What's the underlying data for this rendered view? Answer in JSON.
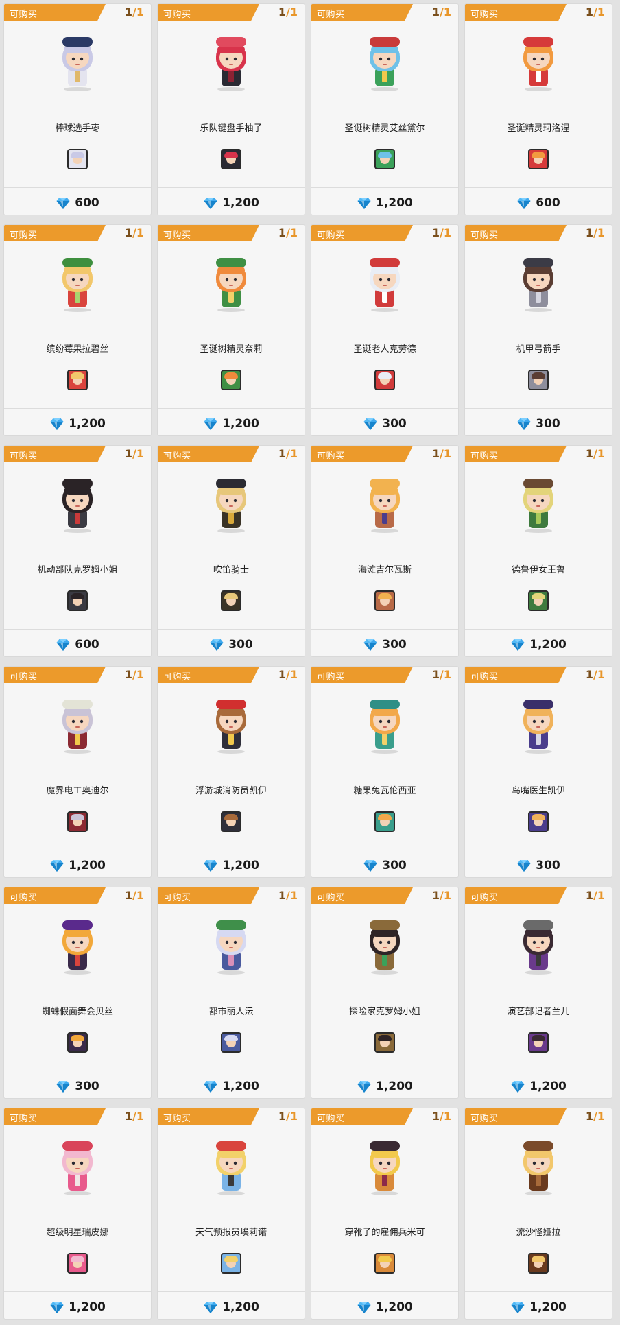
{
  "shop": {
    "cards": [
      {
        "badge": "可购买",
        "stock_current": "1",
        "stock_max": "1",
        "name": "棒球选手枣",
        "price": "600",
        "colors": {
          "hair": "#c9c9e6",
          "hat": "#2b3a66",
          "outfit": "#e4e4ef",
          "accent": "#e0b86a"
        }
      },
      {
        "badge": "可购买",
        "stock_current": "1",
        "stock_max": "1",
        "name": "乐队键盘手柚子",
        "price": "1,200",
        "colors": {
          "hair": "#d8334b",
          "hat": "#e14a5e",
          "outfit": "#2a2a33",
          "accent": "#8c2233"
        }
      },
      {
        "badge": "可购买",
        "stock_current": "1",
        "stock_max": "1",
        "name": "圣诞树精灵艾丝黛尔",
        "price": "1,200",
        "colors": {
          "hair": "#6fc1e8",
          "hat": "#c93a3a",
          "outfit": "#3ba15a",
          "accent": "#f2c94c"
        }
      },
      {
        "badge": "可购买",
        "stock_current": "1",
        "stock_max": "1",
        "name": "圣诞精灵珂洛涅",
        "price": "600",
        "colors": {
          "hair": "#f29a3f",
          "hat": "#d63a3a",
          "outfit": "#d63a3a",
          "accent": "#ffffff"
        }
      },
      {
        "badge": "可购买",
        "stock_current": "1",
        "stock_max": "1",
        "name": "缤纷莓果拉碧丝",
        "price": "1,200",
        "colors": {
          "hair": "#f2c76b",
          "hat": "#3e8f3e",
          "outfit": "#d9443d",
          "accent": "#a8d46f"
        }
      },
      {
        "badge": "可购买",
        "stock_current": "1",
        "stock_max": "1",
        "name": "圣诞树精灵奈莉",
        "price": "1,200",
        "colors": {
          "hair": "#f08a3c",
          "hat": "#3f8f44",
          "outfit": "#3f8f44",
          "accent": "#f2d16a"
        }
      },
      {
        "badge": "可购买",
        "stock_current": "1",
        "stock_max": "1",
        "name": "圣诞老人克劳德",
        "price": "300",
        "colors": {
          "hair": "#e9edf5",
          "hat": "#d13b3b",
          "outfit": "#d13b3b",
          "accent": "#ffffff"
        }
      },
      {
        "badge": "可购买",
        "stock_current": "1",
        "stock_max": "1",
        "name": "机甲弓箭手",
        "price": "300",
        "colors": {
          "hair": "#5a3d33",
          "hat": "#3b3b46",
          "outfit": "#8e8e9c",
          "accent": "#d6d6e0"
        }
      },
      {
        "badge": "可购买",
        "stock_current": "1",
        "stock_max": "1",
        "name": "机动部队克罗姆小姐",
        "price": "600",
        "colors": {
          "hair": "#2a2326",
          "hat": "#2a2326",
          "outfit": "#3a3a42",
          "accent": "#c93a3a"
        }
      },
      {
        "badge": "可购买",
        "stock_current": "1",
        "stock_max": "1",
        "name": "吹笛骑士",
        "price": "300",
        "colors": {
          "hair": "#e7c77a",
          "hat": "#2b2b33",
          "outfit": "#3a3326",
          "accent": "#d9a93a"
        }
      },
      {
        "badge": "可购买",
        "stock_current": "1",
        "stock_max": "1",
        "name": "海滩吉尔瓦斯",
        "price": "300",
        "colors": {
          "hair": "#f2b24f",
          "hat": "#f2b24f",
          "outfit": "#b86a48",
          "accent": "#4a3d8c"
        }
      },
      {
        "badge": "可购买",
        "stock_current": "1",
        "stock_max": "1",
        "name": "德鲁伊女王鲁",
        "price": "1,200",
        "colors": {
          "hair": "#e3d47a",
          "hat": "#6a4a33",
          "outfit": "#3e7a3e",
          "accent": "#a8c95a"
        }
      },
      {
        "badge": "可购买",
        "stock_current": "1",
        "stock_max": "1",
        "name": "魔界电工奥迪尔",
        "price": "1,200",
        "colors": {
          "hair": "#c9c3d6",
          "hat": "#e3e3d6",
          "outfit": "#8c2a33",
          "accent": "#f2c94c"
        }
      },
      {
        "badge": "可购买",
        "stock_current": "1",
        "stock_max": "1",
        "name": "浮游城消防员凯伊",
        "price": "1,200",
        "colors": {
          "hair": "#a86a3a",
          "hat": "#d12f2f",
          "outfit": "#2f2f3a",
          "accent": "#f2c94c"
        }
      },
      {
        "badge": "可购买",
        "stock_current": "1",
        "stock_max": "1",
        "name": "糖果兔瓦伦西亚",
        "price": "300",
        "colors": {
          "hair": "#f2a84a",
          "hat": "#2f8f86",
          "outfit": "#3a9e8c",
          "accent": "#f2d16a"
        }
      },
      {
        "badge": "可购买",
        "stock_current": "1",
        "stock_max": "1",
        "name": "鸟嘴医生凯伊",
        "price": "300",
        "colors": {
          "hair": "#f0b25a",
          "hat": "#3a2f6a",
          "outfit": "#4a3d8c",
          "accent": "#d9d9e6"
        }
      },
      {
        "badge": "可购买",
        "stock_current": "1",
        "stock_max": "1",
        "name": "蜘蛛假面舞会贝丝",
        "price": "300",
        "colors": {
          "hair": "#f2a83a",
          "hat": "#5a2a8c",
          "outfit": "#3a2a4a",
          "accent": "#d9443d"
        }
      },
      {
        "badge": "可购买",
        "stock_current": "1",
        "stock_max": "1",
        "name": "都市丽人沄",
        "price": "1,200",
        "colors": {
          "hair": "#d6d9f2",
          "hat": "#3f8f4a",
          "outfit": "#4a5a9e",
          "accent": "#d98fb8"
        }
      },
      {
        "badge": "可购买",
        "stock_current": "1",
        "stock_max": "1",
        "name": "探险家克罗姆小姐",
        "price": "1,200",
        "colors": {
          "hair": "#2e2426",
          "hat": "#8a6a3a",
          "outfit": "#8a6a3a",
          "accent": "#3ba15a"
        }
      },
      {
        "badge": "可购买",
        "stock_current": "1",
        "stock_max": "1",
        "name": "演艺部记者兰儿",
        "price": "1,200",
        "colors": {
          "hair": "#3a2a33",
          "hat": "#6a6a6a",
          "outfit": "#6a3a8c",
          "accent": "#3a3a3a"
        }
      },
      {
        "badge": "可购买",
        "stock_current": "1",
        "stock_max": "1",
        "name": "超级明星瑞皮娜",
        "price": "1,200",
        "colors": {
          "hair": "#f2b8cf",
          "hat": "#d9445a",
          "outfit": "#e85a8c",
          "accent": "#f0e6e6"
        }
      },
      {
        "badge": "可购买",
        "stock_current": "1",
        "stock_max": "1",
        "name": "天气预报员埃莉诺",
        "price": "1,200",
        "colors": {
          "hair": "#f2d16a",
          "hat": "#d9443d",
          "outfit": "#7ab3e6",
          "accent": "#3a3a3a"
        }
      },
      {
        "badge": "可购买",
        "stock_current": "1",
        "stock_max": "1",
        "name": "穿靴子的雇佣兵米可",
        "price": "1,200",
        "colors": {
          "hair": "#f2c94c",
          "hat": "#3a2a33",
          "outfit": "#d98a3a",
          "accent": "#8c2a4a"
        }
      },
      {
        "badge": "可购买",
        "stock_current": "1",
        "stock_max": "1",
        "name": "流沙怪娅拉",
        "price": "1,200",
        "colors": {
          "hair": "#f2c76b",
          "hat": "#7a4a2a",
          "outfit": "#6a3a1e",
          "accent": "#a86a3a"
        }
      }
    ]
  },
  "colors": {
    "badge": "#ec9a2b",
    "gem": "#2aa0e8",
    "card_bg": "#f6f6f6"
  }
}
